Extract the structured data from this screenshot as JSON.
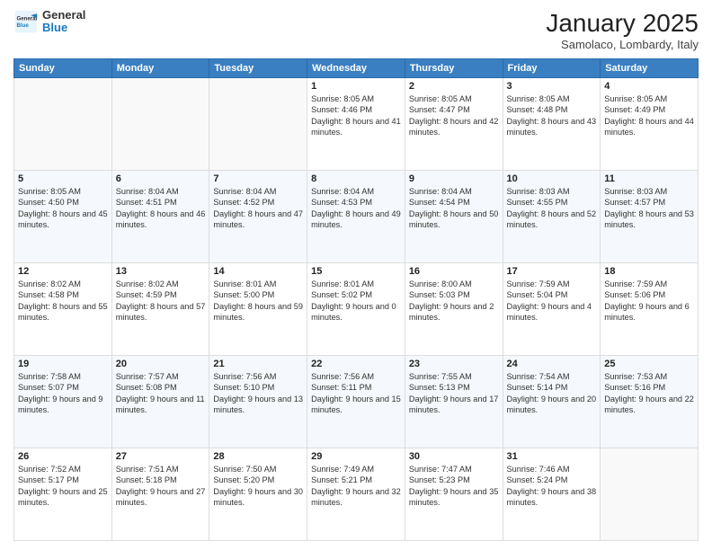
{
  "logo": {
    "general": "General",
    "blue": "Blue"
  },
  "header": {
    "month": "January 2025",
    "location": "Samolaco, Lombardy, Italy"
  },
  "weekdays": [
    "Sunday",
    "Monday",
    "Tuesday",
    "Wednesday",
    "Thursday",
    "Friday",
    "Saturday"
  ],
  "weeks": [
    [
      {
        "day": "",
        "info": ""
      },
      {
        "day": "",
        "info": ""
      },
      {
        "day": "",
        "info": ""
      },
      {
        "day": "1",
        "info": "Sunrise: 8:05 AM\nSunset: 4:46 PM\nDaylight: 8 hours and 41 minutes."
      },
      {
        "day": "2",
        "info": "Sunrise: 8:05 AM\nSunset: 4:47 PM\nDaylight: 8 hours and 42 minutes."
      },
      {
        "day": "3",
        "info": "Sunrise: 8:05 AM\nSunset: 4:48 PM\nDaylight: 8 hours and 43 minutes."
      },
      {
        "day": "4",
        "info": "Sunrise: 8:05 AM\nSunset: 4:49 PM\nDaylight: 8 hours and 44 minutes."
      }
    ],
    [
      {
        "day": "5",
        "info": "Sunrise: 8:05 AM\nSunset: 4:50 PM\nDaylight: 8 hours and 45 minutes."
      },
      {
        "day": "6",
        "info": "Sunrise: 8:04 AM\nSunset: 4:51 PM\nDaylight: 8 hours and 46 minutes."
      },
      {
        "day": "7",
        "info": "Sunrise: 8:04 AM\nSunset: 4:52 PM\nDaylight: 8 hours and 47 minutes."
      },
      {
        "day": "8",
        "info": "Sunrise: 8:04 AM\nSunset: 4:53 PM\nDaylight: 8 hours and 49 minutes."
      },
      {
        "day": "9",
        "info": "Sunrise: 8:04 AM\nSunset: 4:54 PM\nDaylight: 8 hours and 50 minutes."
      },
      {
        "day": "10",
        "info": "Sunrise: 8:03 AM\nSunset: 4:55 PM\nDaylight: 8 hours and 52 minutes."
      },
      {
        "day": "11",
        "info": "Sunrise: 8:03 AM\nSunset: 4:57 PM\nDaylight: 8 hours and 53 minutes."
      }
    ],
    [
      {
        "day": "12",
        "info": "Sunrise: 8:02 AM\nSunset: 4:58 PM\nDaylight: 8 hours and 55 minutes."
      },
      {
        "day": "13",
        "info": "Sunrise: 8:02 AM\nSunset: 4:59 PM\nDaylight: 8 hours and 57 minutes."
      },
      {
        "day": "14",
        "info": "Sunrise: 8:01 AM\nSunset: 5:00 PM\nDaylight: 8 hours and 59 minutes."
      },
      {
        "day": "15",
        "info": "Sunrise: 8:01 AM\nSunset: 5:02 PM\nDaylight: 9 hours and 0 minutes."
      },
      {
        "day": "16",
        "info": "Sunrise: 8:00 AM\nSunset: 5:03 PM\nDaylight: 9 hours and 2 minutes."
      },
      {
        "day": "17",
        "info": "Sunrise: 7:59 AM\nSunset: 5:04 PM\nDaylight: 9 hours and 4 minutes."
      },
      {
        "day": "18",
        "info": "Sunrise: 7:59 AM\nSunset: 5:06 PM\nDaylight: 9 hours and 6 minutes."
      }
    ],
    [
      {
        "day": "19",
        "info": "Sunrise: 7:58 AM\nSunset: 5:07 PM\nDaylight: 9 hours and 9 minutes."
      },
      {
        "day": "20",
        "info": "Sunrise: 7:57 AM\nSunset: 5:08 PM\nDaylight: 9 hours and 11 minutes."
      },
      {
        "day": "21",
        "info": "Sunrise: 7:56 AM\nSunset: 5:10 PM\nDaylight: 9 hours and 13 minutes."
      },
      {
        "day": "22",
        "info": "Sunrise: 7:56 AM\nSunset: 5:11 PM\nDaylight: 9 hours and 15 minutes."
      },
      {
        "day": "23",
        "info": "Sunrise: 7:55 AM\nSunset: 5:13 PM\nDaylight: 9 hours and 17 minutes."
      },
      {
        "day": "24",
        "info": "Sunrise: 7:54 AM\nSunset: 5:14 PM\nDaylight: 9 hours and 20 minutes."
      },
      {
        "day": "25",
        "info": "Sunrise: 7:53 AM\nSunset: 5:16 PM\nDaylight: 9 hours and 22 minutes."
      }
    ],
    [
      {
        "day": "26",
        "info": "Sunrise: 7:52 AM\nSunset: 5:17 PM\nDaylight: 9 hours and 25 minutes."
      },
      {
        "day": "27",
        "info": "Sunrise: 7:51 AM\nSunset: 5:18 PM\nDaylight: 9 hours and 27 minutes."
      },
      {
        "day": "28",
        "info": "Sunrise: 7:50 AM\nSunset: 5:20 PM\nDaylight: 9 hours and 30 minutes."
      },
      {
        "day": "29",
        "info": "Sunrise: 7:49 AM\nSunset: 5:21 PM\nDaylight: 9 hours and 32 minutes."
      },
      {
        "day": "30",
        "info": "Sunrise: 7:47 AM\nSunset: 5:23 PM\nDaylight: 9 hours and 35 minutes."
      },
      {
        "day": "31",
        "info": "Sunrise: 7:46 AM\nSunset: 5:24 PM\nDaylight: 9 hours and 38 minutes."
      },
      {
        "day": "",
        "info": ""
      }
    ]
  ]
}
